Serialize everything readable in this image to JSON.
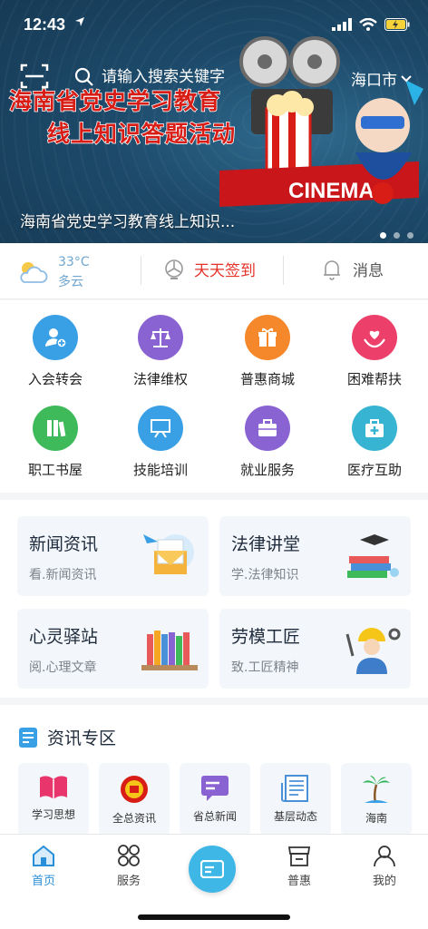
{
  "status_bar": {
    "time": "12:43"
  },
  "search": {
    "placeholder": "请输入搜索关键字",
    "city": "海口市"
  },
  "banner": {
    "headline_line1": "海南省党史学习教育",
    "headline_line2": "线上知识答题活动",
    "art_text": "CINEMA",
    "caption": "海南省党史学习教育线上知识..."
  },
  "info_bar": {
    "temperature": "33°C",
    "weather": "多云",
    "checkin_label": "天天签到",
    "message_label": "消息"
  },
  "services": [
    {
      "label": "入会转会",
      "icon": "user-plus-icon",
      "color": "#3aa0e6"
    },
    {
      "label": "法律维权",
      "icon": "scales-icon",
      "color": "#8a63d2"
    },
    {
      "label": "普惠商城",
      "icon": "gift-icon",
      "color": "#f5882b"
    },
    {
      "label": "困难帮扶",
      "icon": "heart-hand-icon",
      "color": "#ec3f6a"
    },
    {
      "label": "职工书屋",
      "icon": "books-icon",
      "color": "#3fba5a"
    },
    {
      "label": "技能培训",
      "icon": "easel-icon",
      "color": "#3aa0e6"
    },
    {
      "label": "就业服务",
      "icon": "briefcase-icon",
      "color": "#8a63d2"
    },
    {
      "label": "医疗互助",
      "icon": "medical-kit-icon",
      "color": "#37b4d2"
    }
  ],
  "features": [
    {
      "title": "新闻资讯",
      "subtitle": "看.新闻资讯"
    },
    {
      "title": "法律讲堂",
      "subtitle": "学.法律知识"
    },
    {
      "title": "心灵驿站",
      "subtitle": "阅.心理文章"
    },
    {
      "title": "劳模工匠",
      "subtitle": "致.工匠精神"
    }
  ],
  "news_zone": {
    "title": "资讯专区",
    "items": [
      {
        "label": "学习思想",
        "icon": "open-book-icon"
      },
      {
        "label": "全总资讯",
        "icon": "union-emblem-icon"
      },
      {
        "label": "省总新闻",
        "icon": "chat-bubble-icon"
      },
      {
        "label": "基层动态",
        "icon": "newspaper-icon"
      },
      {
        "label": "海南",
        "icon": "palm-tree-icon"
      }
    ]
  },
  "tabbar": [
    {
      "label": "首页",
      "icon": "home-icon",
      "active": true
    },
    {
      "label": "服务",
      "icon": "grid-icon"
    },
    {
      "label": "普惠",
      "icon": "shop-icon"
    },
    {
      "label": "我的",
      "icon": "user-icon"
    }
  ],
  "colors": {
    "accent": "#2a8fd9",
    "checkin": "#e6322b",
    "headline": "#d81d16"
  }
}
